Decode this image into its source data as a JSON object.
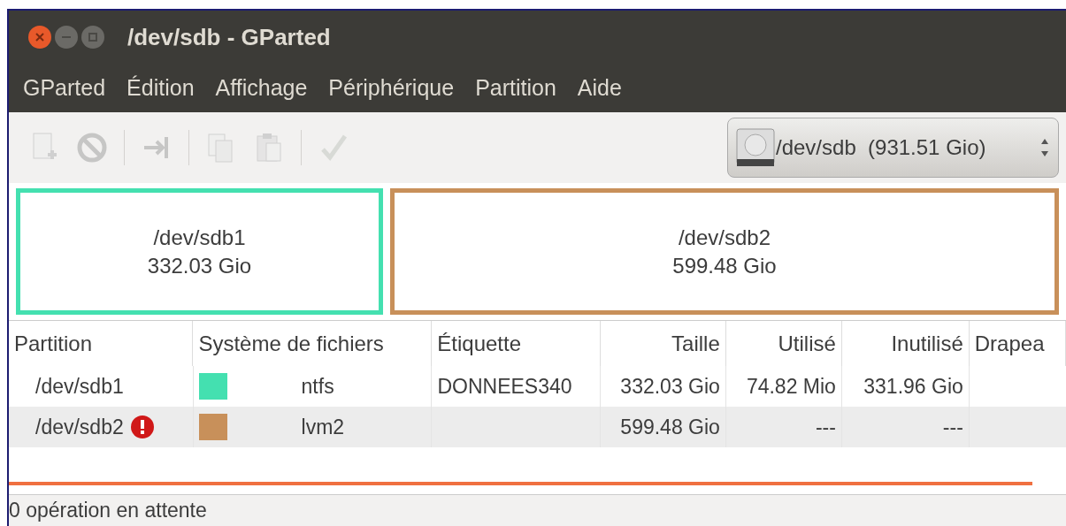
{
  "window": {
    "title": "/dev/sdb - GParted"
  },
  "menu": [
    "GParted",
    "Édition",
    "Affichage",
    "Périphérique",
    "Partition",
    "Aide"
  ],
  "toolbar": [
    {
      "kind": "new",
      "disabled": true
    },
    {
      "kind": "delete",
      "disabled": true
    },
    {
      "kind": "sep"
    },
    {
      "kind": "resize",
      "disabled": true
    },
    {
      "kind": "sep"
    },
    {
      "kind": "copy",
      "disabled": true
    },
    {
      "kind": "paste",
      "disabled": true
    },
    {
      "kind": "sep"
    },
    {
      "kind": "apply",
      "disabled": true
    }
  ],
  "device_selector": {
    "value": "/dev/sdb  (931.51 Gio)"
  },
  "partition_map": [
    {
      "name": "/dev/sdb1",
      "size": "332.03 Gio",
      "color": "#44e0b0"
    },
    {
      "name": "/dev/sdb2",
      "size": "599.48 Gio",
      "color": "#c8905a"
    }
  ],
  "table": {
    "columns": [
      "Partition",
      "Système de fichiers",
      "Étiquette",
      "Taille",
      "Utilisé",
      "Inutilisé",
      "Drapea"
    ],
    "rows": [
      {
        "partition": "/dev/sdb1",
        "warning": false,
        "color": "#44e0b0",
        "filesystem": "ntfs",
        "label": "DONNEES340",
        "size": "332.03 Gio",
        "used": "74.82 Mio",
        "unused": "331.96 Gio"
      },
      {
        "partition": "/dev/sdb2",
        "warning": true,
        "color": "#c8905a",
        "filesystem": "lvm2",
        "size": "599.48 Gio",
        "used": "---",
        "unused": "---"
      }
    ]
  },
  "status_bar": "0 opération en attente"
}
